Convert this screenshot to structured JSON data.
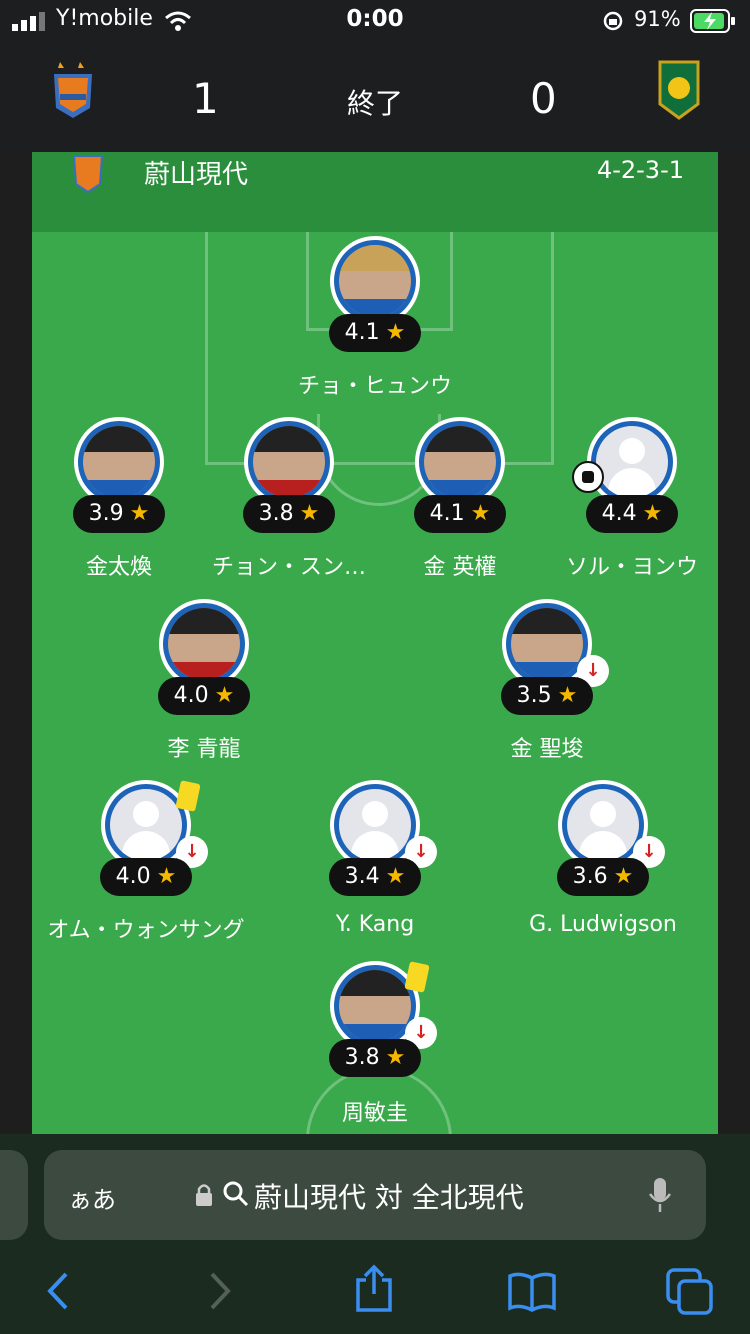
{
  "status_bar": {
    "carrier": "Y!mobile",
    "time": "0:00",
    "battery": "91%"
  },
  "match": {
    "home_score": "1",
    "status": "終了",
    "away_score": "0"
  },
  "team": {
    "name": "蔚山現代",
    "formation": "4-2-3-1"
  },
  "players": [
    {
      "name": "チョ・ヒュンウ",
      "rating": "4.1"
    },
    {
      "name": "金太煥",
      "rating": "3.9"
    },
    {
      "name": "チョン・スン…",
      "rating": "3.8"
    },
    {
      "name": "金 英權",
      "rating": "4.1"
    },
    {
      "name": "ソル・ヨンウ",
      "rating": "4.4"
    },
    {
      "name": "李 青龍",
      "rating": "4.0"
    },
    {
      "name": "金 聖埈",
      "rating": "3.5"
    },
    {
      "name": "オム・ウォンサング",
      "rating": "4.0"
    },
    {
      "name": "Y. Kang",
      "rating": "3.4"
    },
    {
      "name": "G. Ludwigson",
      "rating": "3.6"
    },
    {
      "name": "周敏圭",
      "rating": "3.8"
    }
  ],
  "star_glyph": "★",
  "sub_glyph": "↓",
  "browser": {
    "aa_label": "ぁあ",
    "url_text": "蔚山現代 対 全北現代"
  },
  "colors": {
    "pitch": "#3aa94b",
    "header_green": "#2a8e3c",
    "rating_star": "#f5b800",
    "accent": "#3a8ef0"
  }
}
